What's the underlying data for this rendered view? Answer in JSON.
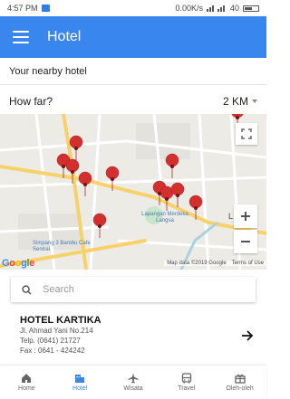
{
  "status_bar": {
    "time": "4:57 PM",
    "network": "0.00K/s",
    "battery": "40"
  },
  "app_bar": {
    "title": "Hotel",
    "menu_icon": "hamburger-menu-icon"
  },
  "nearby": {
    "label": "Your nearby hotel"
  },
  "distance_filter": {
    "label": "How far?",
    "selected": "2 KM"
  },
  "map": {
    "labels": {
      "area": "Lapangan Merdeka Langsa",
      "place": "Simpang 3 Bambu Cafe Sentral",
      "edge_label": "L"
    },
    "attribution": "Map data ©2019 Google",
    "terms": "Terms of Use",
    "logo": "Google",
    "marker_color": "#d32f2f",
    "road_color": "#f7d16a"
  },
  "search": {
    "placeholder": "Search",
    "value": ""
  },
  "hotel": {
    "name": "HOTEL KARTIKA",
    "address": "Jl. Ahmad Yani No.214",
    "phone": "Telp. (0641) 21727",
    "fax": "Fax : 0641 - 424242"
  },
  "bottom_nav": [
    {
      "label": "Home",
      "icon": "home-icon",
      "active": false
    },
    {
      "label": "Hotel",
      "icon": "hotel-icon",
      "active": true
    },
    {
      "label": "Wisata",
      "icon": "airplane-icon",
      "active": false
    },
    {
      "label": "Travel",
      "icon": "bus-icon",
      "active": false
    },
    {
      "label": "Oleh-oleh",
      "icon": "gift-icon",
      "active": false
    }
  ],
  "colors": {
    "primary": "#3a86ef",
    "marker": "#d32f2f"
  }
}
